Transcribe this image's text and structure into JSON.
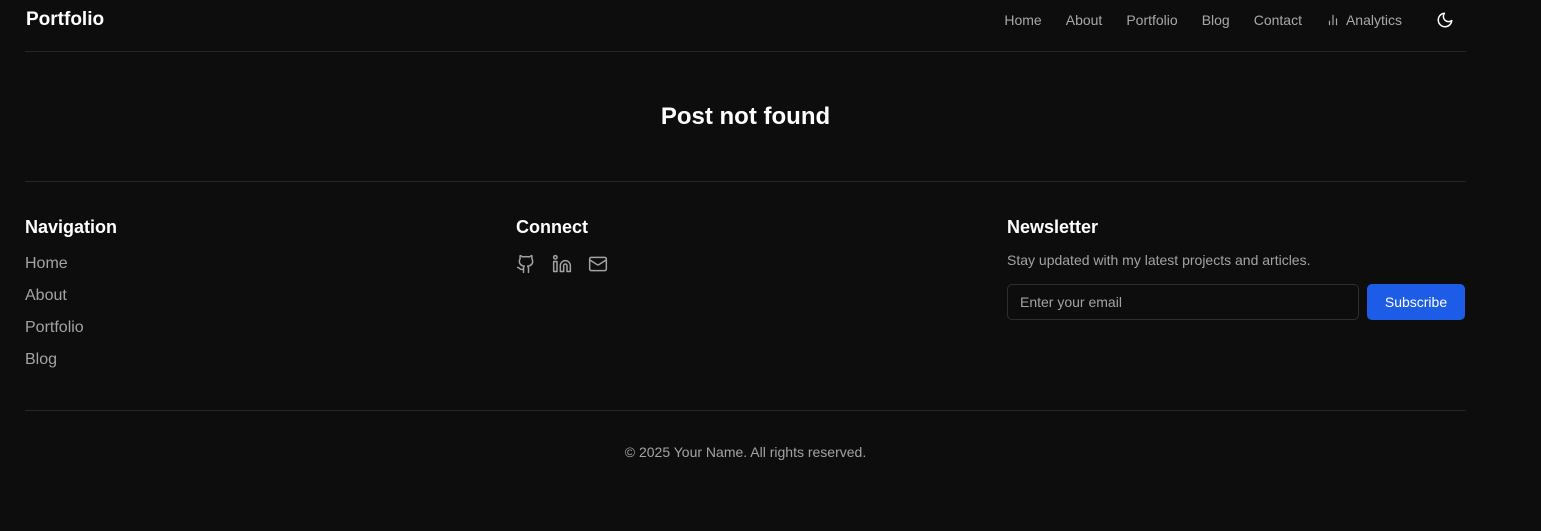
{
  "header": {
    "brand": "Portfolio",
    "nav": [
      {
        "label": "Home"
      },
      {
        "label": "About"
      },
      {
        "label": "Portfolio"
      },
      {
        "label": "Blog"
      },
      {
        "label": "Contact"
      },
      {
        "label": "Analytics",
        "icon": "bar-chart-icon"
      }
    ],
    "theme_toggle_icon": "moon-icon"
  },
  "main": {
    "heading": "Post not found"
  },
  "footer": {
    "navigation": {
      "title": "Navigation",
      "links": [
        "Home",
        "About",
        "Portfolio",
        "Blog"
      ]
    },
    "connect": {
      "title": "Connect",
      "icons": [
        "github-icon",
        "linkedin-icon",
        "mail-icon"
      ]
    },
    "newsletter": {
      "title": "Newsletter",
      "description": "Stay updated with my latest projects and articles.",
      "email_placeholder": "Enter your email",
      "email_value": "",
      "button_label": "Subscribe"
    },
    "copyright": "© 2025 Your Name. All rights reserved."
  },
  "colors": {
    "background": "#0d0d0d",
    "border": "#262626",
    "muted_text": "#a3a3a3",
    "accent": "#1d5ce6"
  }
}
